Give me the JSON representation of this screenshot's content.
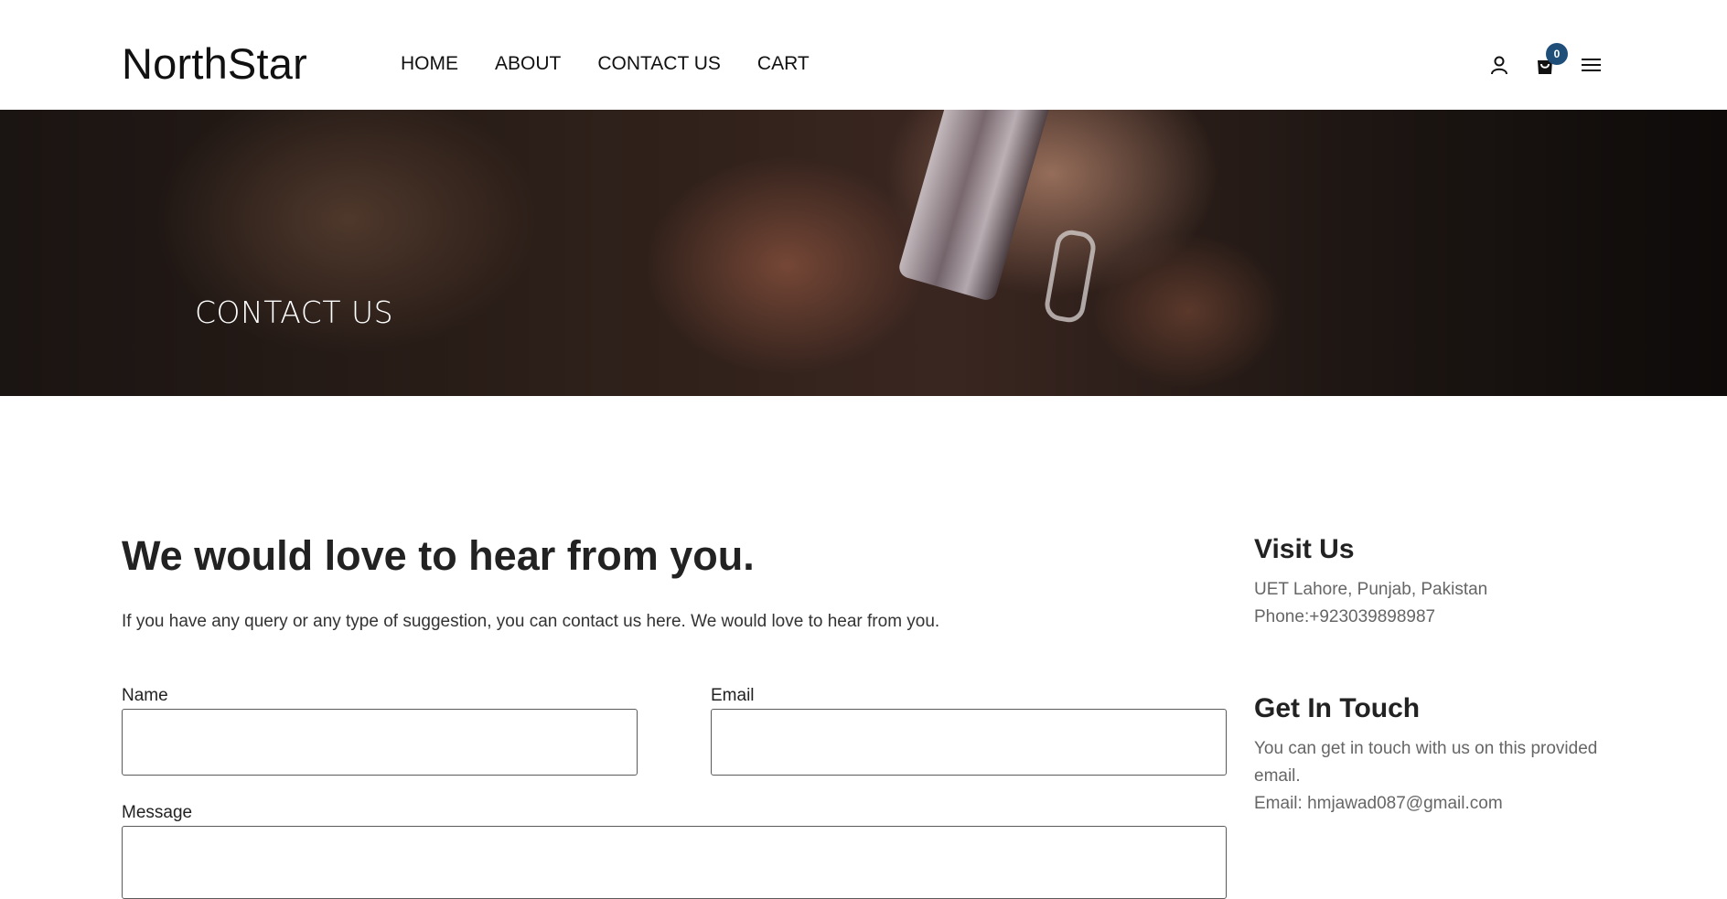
{
  "header": {
    "logo": "NorthStar",
    "nav": [
      "HOME",
      "ABOUT",
      "CONTACT US",
      "CART"
    ],
    "icons": [
      "user-icon",
      "shopping-bag-icon",
      "hamburger-menu-icon"
    ],
    "cart_count": "0",
    "badge_color": "#1f4e79"
  },
  "hero": {
    "title": "CONTACT US"
  },
  "main": {
    "heading": "We would love to hear from you.",
    "intro": "If you have any query or any type of suggestion, you can contact us here. We would love to hear from you.",
    "form": {
      "name_label": "Name",
      "name_value": "",
      "email_label": "Email",
      "email_value": "",
      "message_label": "Message",
      "message_value": ""
    }
  },
  "sidebar": {
    "visit": {
      "title": "Visit Us",
      "address": "UET Lahore, Punjab, Pakistan",
      "phone": "Phone:+923039898987"
    },
    "touch": {
      "title": "Get In Touch",
      "text_line1": "You can get in touch with us on this provided",
      "text_line2": "email.",
      "email": "Email: hmjawad087@gmail.com"
    }
  }
}
